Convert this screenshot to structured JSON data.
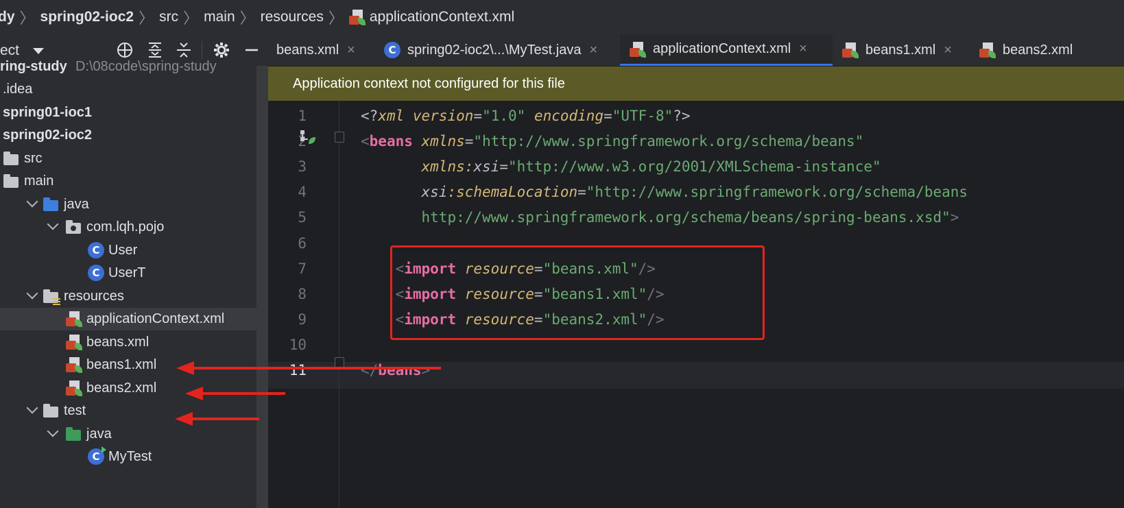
{
  "breadcrumb": [
    {
      "label": "dy",
      "bold": true
    },
    {
      "label": "spring02-ioc2",
      "bold": true
    },
    {
      "label": "src",
      "bold": false
    },
    {
      "label": "main",
      "bold": false
    },
    {
      "label": "resources",
      "bold": false
    },
    {
      "label": "applicationContext.xml",
      "bold": false,
      "icon": "xml-spring-icon"
    }
  ],
  "project_panel": {
    "title": "ect",
    "toolbar": [
      "locate-icon",
      "expand-all-icon",
      "collapse-all-icon",
      "settings-icon",
      "minimize-icon"
    ]
  },
  "tree": [
    {
      "label": "ring-study",
      "bold": true,
      "path": "D:\\08code\\spring-study"
    },
    {
      "label": ".idea"
    },
    {
      "label": "spring01-ioc1",
      "bold": true
    },
    {
      "label": "spring02-ioc2",
      "bold": true
    },
    {
      "label": "src"
    },
    {
      "label": "main"
    },
    {
      "label": "java"
    },
    {
      "label": "com.lqh.pojo"
    },
    {
      "label": "User"
    },
    {
      "label": "UserT"
    },
    {
      "label": "resources"
    },
    {
      "label": "applicationContext.xml"
    },
    {
      "label": "beans.xml"
    },
    {
      "label": "beans1.xml"
    },
    {
      "label": "beans2.xml"
    },
    {
      "label": "test"
    },
    {
      "label": "java"
    },
    {
      "label": "MyTest"
    }
  ],
  "tabs": [
    {
      "label": "beans.xml",
      "icon": "xml-icon",
      "active": false
    },
    {
      "label": "spring02-ioc2\\...\\MyTest.java",
      "icon": "java-class-icon",
      "active": false
    },
    {
      "label": "applicationContext.xml",
      "icon": "xml-spring-icon",
      "active": true
    },
    {
      "label": "beans1.xml",
      "icon": "xml-spring-icon",
      "active": false
    },
    {
      "label": "beans2.xml",
      "icon": "xml-spring-icon",
      "active": false
    }
  ],
  "close_glyph": "×",
  "banner": {
    "text": "Application context not configured for this file"
  },
  "editor": {
    "current_line": 11,
    "lines": [
      {
        "n": "1",
        "tokens": [
          [
            "plain",
            "<?"
          ],
          [
            "pi",
            "xml"
          ],
          [
            "plain",
            " "
          ],
          [
            "pi",
            "version"
          ],
          [
            "eq",
            "="
          ],
          [
            "str",
            "\"1.0\""
          ],
          [
            "plain",
            " "
          ],
          [
            "pi",
            "encoding"
          ],
          [
            "eq",
            "="
          ],
          [
            "str",
            "\"UTF-8\""
          ],
          [
            "plain",
            "?>"
          ]
        ]
      },
      {
        "n": "2",
        "tokens": [
          [
            "br",
            "<"
          ],
          [
            "tag",
            "beans"
          ],
          [
            "plain",
            " "
          ],
          [
            "attr",
            "xmlns"
          ],
          [
            "eq",
            "="
          ],
          [
            "str",
            "\"http://www.springframework.org/schema/beans\""
          ]
        ]
      },
      {
        "n": "3",
        "tokens": [
          [
            "plain",
            "       "
          ],
          [
            "attr",
            "xmlns:"
          ],
          [
            "plainit",
            "xsi"
          ],
          [
            "eq",
            "="
          ],
          [
            "str",
            "\"http://www.w3.org/2001/XMLSchema-instance\""
          ]
        ]
      },
      {
        "n": "4",
        "tokens": [
          [
            "plain",
            "       "
          ],
          [
            "plainit",
            "xsi"
          ],
          [
            "attr",
            ":schemaLocation"
          ],
          [
            "eq",
            "="
          ],
          [
            "str",
            "\"http://www.springframework.org/schema/beans"
          ]
        ]
      },
      {
        "n": "5",
        "tokens": [
          [
            "plain",
            "       "
          ],
          [
            "str",
            "http://www.springframework.org/schema/beans/spring-beans.xsd\""
          ],
          [
            "br",
            ">"
          ]
        ]
      },
      {
        "n": "6",
        "tokens": []
      },
      {
        "n": "7",
        "tokens": [
          [
            "plain",
            "    "
          ],
          [
            "br",
            "<"
          ],
          [
            "tag",
            "import"
          ],
          [
            "plain",
            " "
          ],
          [
            "attr",
            "resource"
          ],
          [
            "eq",
            "="
          ],
          [
            "str",
            "\"beans.xml\""
          ],
          [
            "br",
            "/>"
          ]
        ]
      },
      {
        "n": "8",
        "tokens": [
          [
            "plain",
            "    "
          ],
          [
            "br",
            "<"
          ],
          [
            "tag",
            "import"
          ],
          [
            "plain",
            " "
          ],
          [
            "attr",
            "resource"
          ],
          [
            "eq",
            "="
          ],
          [
            "str",
            "\"beans1.xml\""
          ],
          [
            "br",
            "/>"
          ]
        ]
      },
      {
        "n": "9",
        "tokens": [
          [
            "plain",
            "    "
          ],
          [
            "br",
            "<"
          ],
          [
            "tag",
            "import"
          ],
          [
            "plain",
            " "
          ],
          [
            "attr",
            "resource"
          ],
          [
            "eq",
            "="
          ],
          [
            "str",
            "\"beans2.xml\""
          ],
          [
            "br",
            "/>"
          ]
        ]
      },
      {
        "n": "10",
        "tokens": []
      },
      {
        "n": "11",
        "tokens": [
          [
            "br",
            "</"
          ],
          [
            "tag",
            "beans"
          ],
          [
            "br",
            ">"
          ]
        ]
      }
    ]
  },
  "colors": {
    "annotation_red": "#e3241e",
    "banner_bg": "#5c5b27",
    "editor_bg": "#1e1f22",
    "panel_bg": "#2b2d30"
  }
}
